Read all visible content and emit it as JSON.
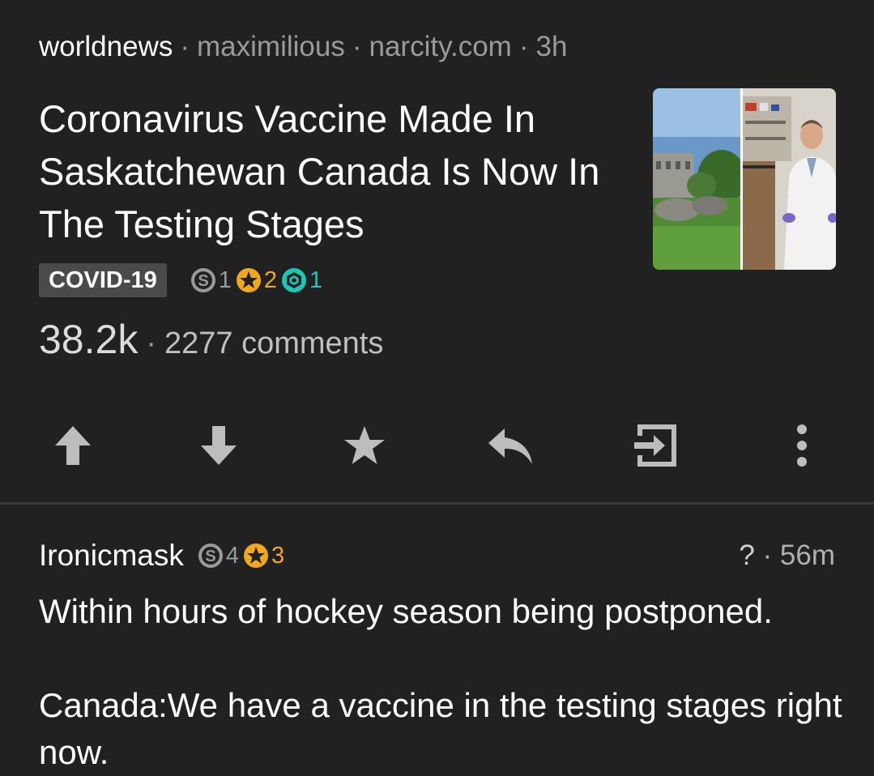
{
  "post": {
    "subreddit": "worldnews",
    "author": "maximilious",
    "domain": "narcity.com",
    "age": "3h",
    "title": "Coronavirus Vaccine Made In Saskatchewan Canada Is Now In The Testing Stages",
    "flair": "COVID-19",
    "awards": [
      {
        "type": "silver",
        "icon": "silver-award-icon",
        "count": "1"
      },
      {
        "type": "gold",
        "icon": "gold-award-icon",
        "count": "2"
      },
      {
        "type": "platinum",
        "icon": "platinum-award-icon",
        "count": "1"
      }
    ],
    "score": "38.2k",
    "comments": "2277 comments",
    "thumbnail": "thumbnail-image"
  },
  "actions": [
    {
      "name": "upvote-icon"
    },
    {
      "name": "downvote-icon"
    },
    {
      "name": "save-star-icon"
    },
    {
      "name": "reply-icon"
    },
    {
      "name": "open-link-icon"
    },
    {
      "name": "more-options-icon"
    }
  ],
  "comment": {
    "author": "Ironicmask",
    "awards": [
      {
        "type": "silver",
        "icon": "silver-award-icon",
        "count": "4"
      },
      {
        "type": "gold",
        "icon": "gold-award-icon",
        "count": "3"
      }
    ],
    "score": "?",
    "age": "56m",
    "body": [
      "Within hours of hockey season being postponed.",
      "Canada:We have a vaccine in the testing stages right now."
    ]
  },
  "colors": {
    "background": "#212121",
    "silver": "#9a9a9a",
    "gold": "#f0a81d",
    "platinum": "#1ec6b4"
  }
}
